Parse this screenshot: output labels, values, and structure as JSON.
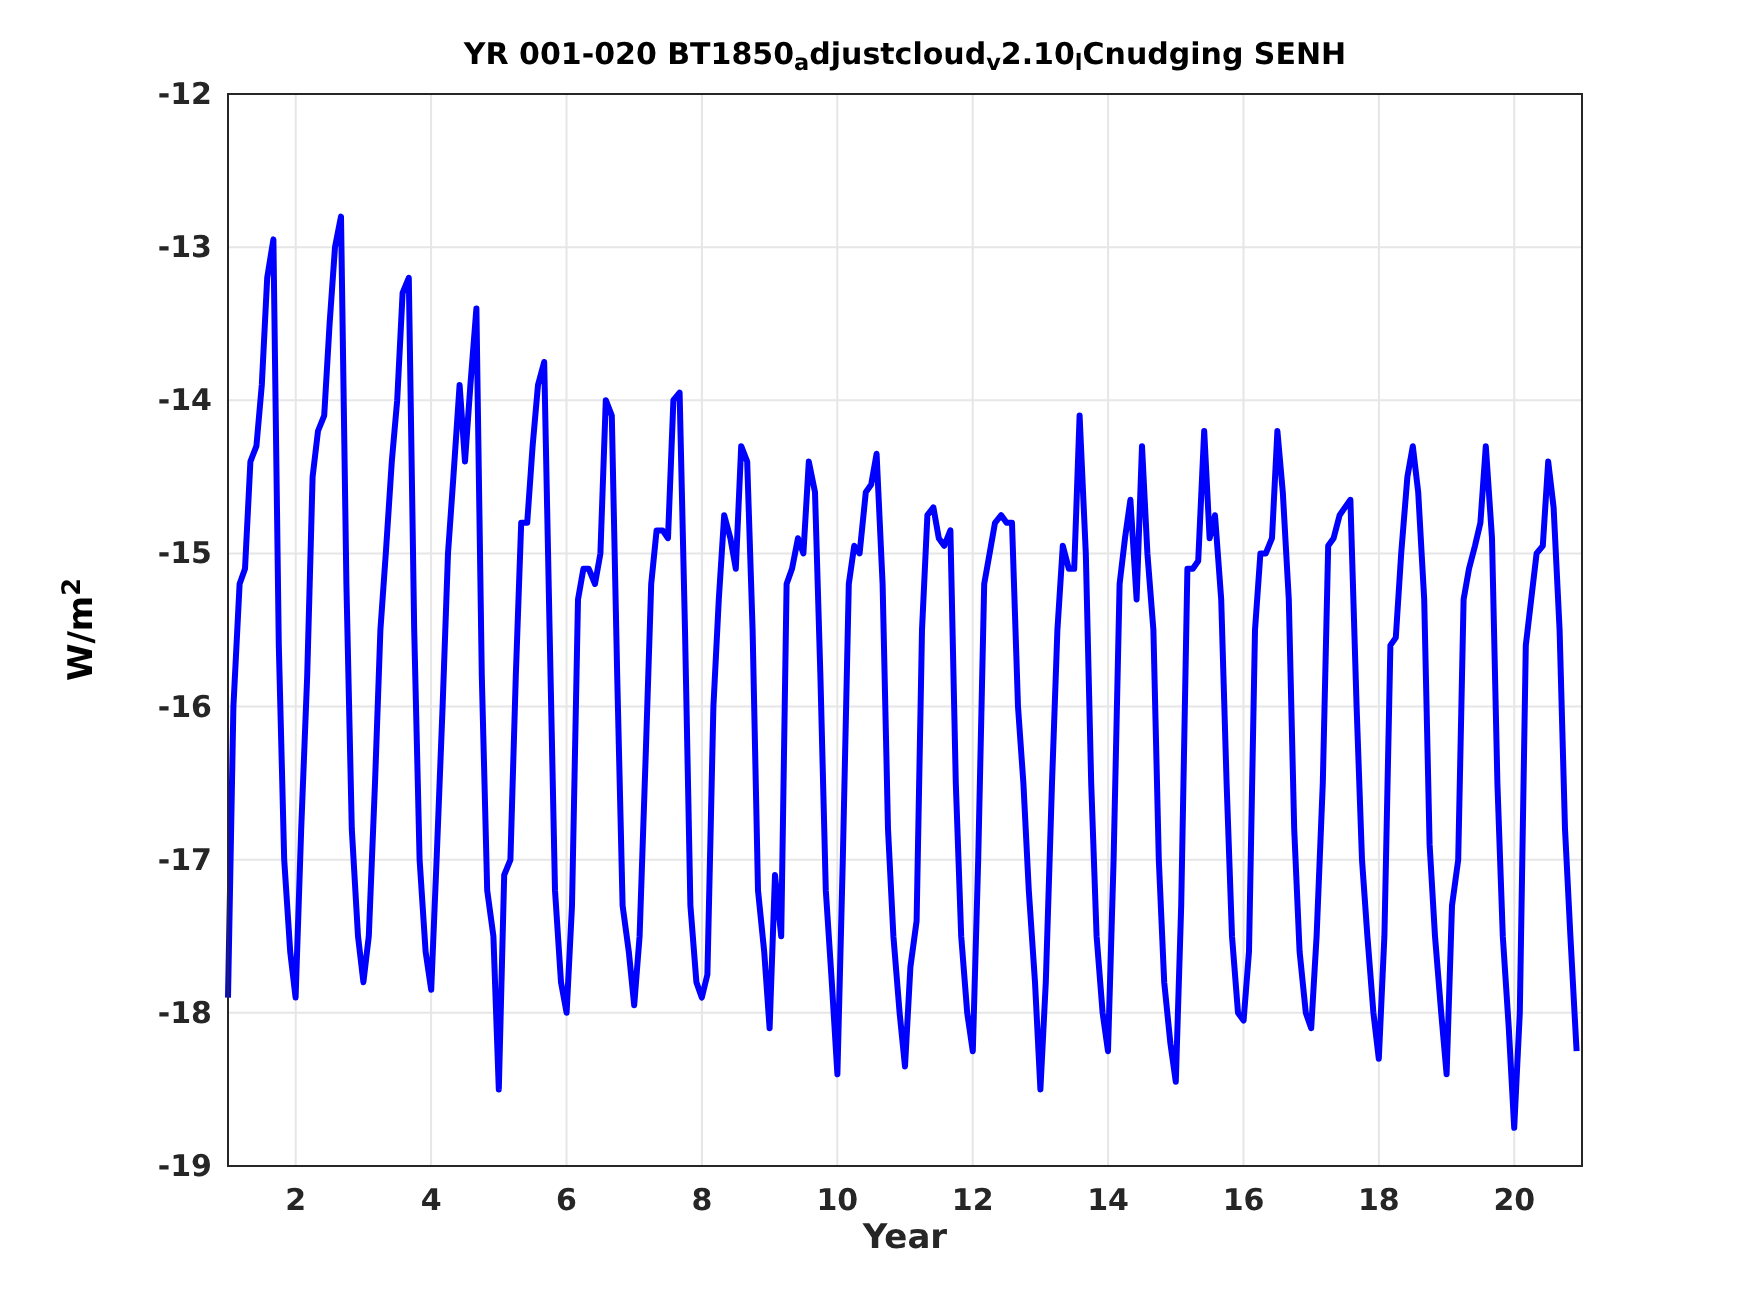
{
  "figure": {
    "chart_data": {
      "type": "line",
      "title": "YR 001-020 BT1850$_{a}$djustcloud$_{v}$2.10$_{l}$Cnudging SENH",
      "xlabel": "Year",
      "ylabel": "W/m$^{2}$",
      "xlim": [
        1,
        21
      ],
      "ylim": [
        -19,
        -12
      ],
      "xticks": [
        2,
        4,
        6,
        8,
        10,
        12,
        14,
        16,
        18,
        20
      ],
      "yticks": [
        -19,
        -18,
        -17,
        -16,
        -15,
        -14,
        -13,
        -12
      ],
      "x": [
        1,
        1.08,
        1.17,
        1.25,
        1.33,
        1.42,
        1.5,
        1.58,
        1.67,
        1.75,
        1.83,
        1.92,
        2,
        2.08,
        2.17,
        2.25,
        2.33,
        2.42,
        2.5,
        2.58,
        2.67,
        2.75,
        2.83,
        2.92,
        3,
        3.08,
        3.17,
        3.25,
        3.33,
        3.42,
        3.5,
        3.58,
        3.67,
        3.75,
        3.83,
        3.92,
        4,
        4.08,
        4.17,
        4.25,
        4.33,
        4.42,
        4.5,
        4.58,
        4.67,
        4.75,
        4.83,
        4.92,
        5,
        5.08,
        5.17,
        5.25,
        5.33,
        5.42,
        5.5,
        5.58,
        5.67,
        5.75,
        5.83,
        5.92,
        6,
        6.08,
        6.17,
        6.25,
        6.33,
        6.42,
        6.5,
        6.58,
        6.67,
        6.75,
        6.83,
        6.92,
        7,
        7.08,
        7.17,
        7.25,
        7.33,
        7.42,
        7.5,
        7.58,
        7.67,
        7.75,
        7.83,
        7.92,
        8,
        8.08,
        8.17,
        8.25,
        8.33,
        8.42,
        8.5,
        8.58,
        8.67,
        8.75,
        8.83,
        8.92,
        9,
        9.08,
        9.17,
        9.25,
        9.33,
        9.42,
        9.5,
        9.58,
        9.67,
        9.75,
        9.83,
        9.92,
        10,
        10.08,
        10.17,
        10.25,
        10.33,
        10.42,
        10.5,
        10.58,
        10.67,
        10.75,
        10.83,
        10.92,
        11,
        11.08,
        11.17,
        11.25,
        11.33,
        11.42,
        11.5,
        11.58,
        11.67,
        11.75,
        11.83,
        11.92,
        12,
        12.08,
        12.17,
        12.25,
        12.33,
        12.42,
        12.5,
        12.58,
        12.67,
        12.75,
        12.83,
        12.92,
        13,
        13.08,
        13.17,
        13.25,
        13.33,
        13.42,
        13.5,
        13.58,
        13.67,
        13.75,
        13.83,
        13.92,
        14,
        14.08,
        14.17,
        14.25,
        14.33,
        14.42,
        14.5,
        14.58,
        14.67,
        14.75,
        14.83,
        14.92,
        15,
        15.08,
        15.17,
        15.25,
        15.33,
        15.42,
        15.5,
        15.58,
        15.67,
        15.75,
        15.83,
        15.92,
        16,
        16.08,
        16.17,
        16.25,
        16.33,
        16.42,
        16.5,
        16.58,
        16.67,
        16.75,
        16.83,
        16.92,
        17,
        17.08,
        17.17,
        17.25,
        17.33,
        17.42,
        17.5,
        17.58,
        17.67,
        17.75,
        17.83,
        17.92,
        18,
        18.08,
        18.17,
        18.25,
        18.33,
        18.42,
        18.5,
        18.58,
        18.67,
        18.75,
        18.83,
        18.92,
        19,
        19.08,
        19.17,
        19.25,
        19.33,
        19.42,
        19.5,
        19.58,
        19.67,
        19.75,
        19.83,
        19.92,
        20,
        20.08,
        20.17,
        20.25,
        20.33,
        20.42,
        20.5,
        20.58,
        20.67,
        20.75,
        20.83,
        20.92
      ],
      "grid": true,
      "series": [
        {
          "color": "#0000ff",
          "values": [
            -17.9,
            -16.0,
            -15.2,
            -15.1,
            -14.4,
            -14.3,
            -13.9,
            -13.2,
            -12.95,
            -15.6,
            -17.0,
            -17.6,
            -17.9,
            -16.8,
            -15.8,
            -14.5,
            -14.2,
            -14.1,
            -13.5,
            -13.0,
            -12.8,
            -15.2,
            -16.8,
            -17.5,
            -17.8,
            -17.5,
            -16.5,
            -15.5,
            -15.0,
            -14.4,
            -14.0,
            -13.3,
            -13.2,
            -15.5,
            -17.0,
            -17.6,
            -17.85,
            -17.0,
            -16.0,
            -15.0,
            -14.5,
            -13.9,
            -14.4,
            -13.9,
            -13.4,
            -15.8,
            -17.2,
            -17.5,
            -18.5,
            -17.1,
            -17.0,
            -15.8,
            -14.8,
            -14.8,
            -14.3,
            -13.9,
            -13.75,
            -15.5,
            -17.2,
            -17.8,
            -18.0,
            -17.3,
            -15.3,
            -15.1,
            -15.1,
            -15.2,
            -15.0,
            -14.0,
            -14.1,
            -15.8,
            -17.3,
            -17.6,
            -17.95,
            -17.5,
            -16.3,
            -15.2,
            -14.85,
            -14.85,
            -14.9,
            -14.0,
            -13.95,
            -15.5,
            -17.3,
            -17.8,
            -17.9,
            -17.75,
            -16.0,
            -15.3,
            -14.75,
            -14.9,
            -15.1,
            -14.3,
            -14.4,
            -15.5,
            -17.2,
            -17.6,
            -18.1,
            -17.1,
            -17.5,
            -15.2,
            -15.1,
            -14.9,
            -15.0,
            -14.4,
            -14.6,
            -15.8,
            -17.2,
            -17.8,
            -18.4,
            -17.0,
            -15.2,
            -14.95,
            -15.0,
            -14.6,
            -14.55,
            -14.35,
            -15.2,
            -16.8,
            -17.5,
            -18.0,
            -18.35,
            -17.7,
            -17.4,
            -15.5,
            -14.75,
            -14.7,
            -14.9,
            -14.95,
            -14.85,
            -16.5,
            -17.5,
            -18.0,
            -18.25,
            -17.0,
            -15.2,
            -15.0,
            -14.8,
            -14.75,
            -14.8,
            -14.8,
            -16.0,
            -16.5,
            -17.2,
            -17.8,
            -18.5,
            -17.8,
            -16.5,
            -15.5,
            -14.95,
            -15.1,
            -15.1,
            -14.1,
            -15.0,
            -16.5,
            -17.5,
            -18.0,
            -18.25,
            -17.0,
            -15.2,
            -14.9,
            -14.65,
            -15.3,
            -14.3,
            -15.0,
            -15.5,
            -17.0,
            -17.8,
            -18.2,
            -18.45,
            -17.3,
            -15.1,
            -15.1,
            -15.05,
            -14.2,
            -14.9,
            -14.75,
            -15.3,
            -16.5,
            -17.5,
            -18.0,
            -18.05,
            -17.6,
            -15.5,
            -15.0,
            -15.0,
            -14.9,
            -14.2,
            -14.6,
            -15.3,
            -16.8,
            -17.6,
            -18.0,
            -18.1,
            -17.5,
            -16.5,
            -14.95,
            -14.9,
            -14.75,
            -14.7,
            -14.65,
            -16.0,
            -17.0,
            -17.5,
            -18.0,
            -18.3,
            -17.5,
            -15.6,
            -15.55,
            -15.0,
            -14.5,
            -14.3,
            -14.6,
            -15.3,
            -16.9,
            -17.5,
            -18.0,
            -18.4,
            -17.3,
            -17.0,
            -15.3,
            -15.1,
            -14.95,
            -14.8,
            -14.3,
            -14.9,
            -16.5,
            -17.5,
            -18.1,
            -18.75,
            -18.0,
            -15.6,
            -15.3,
            -15.0,
            -14.95,
            -14.4,
            -14.7,
            -15.5,
            -16.8,
            -17.5,
            -18.25
          ]
        }
      ]
    }
  }
}
